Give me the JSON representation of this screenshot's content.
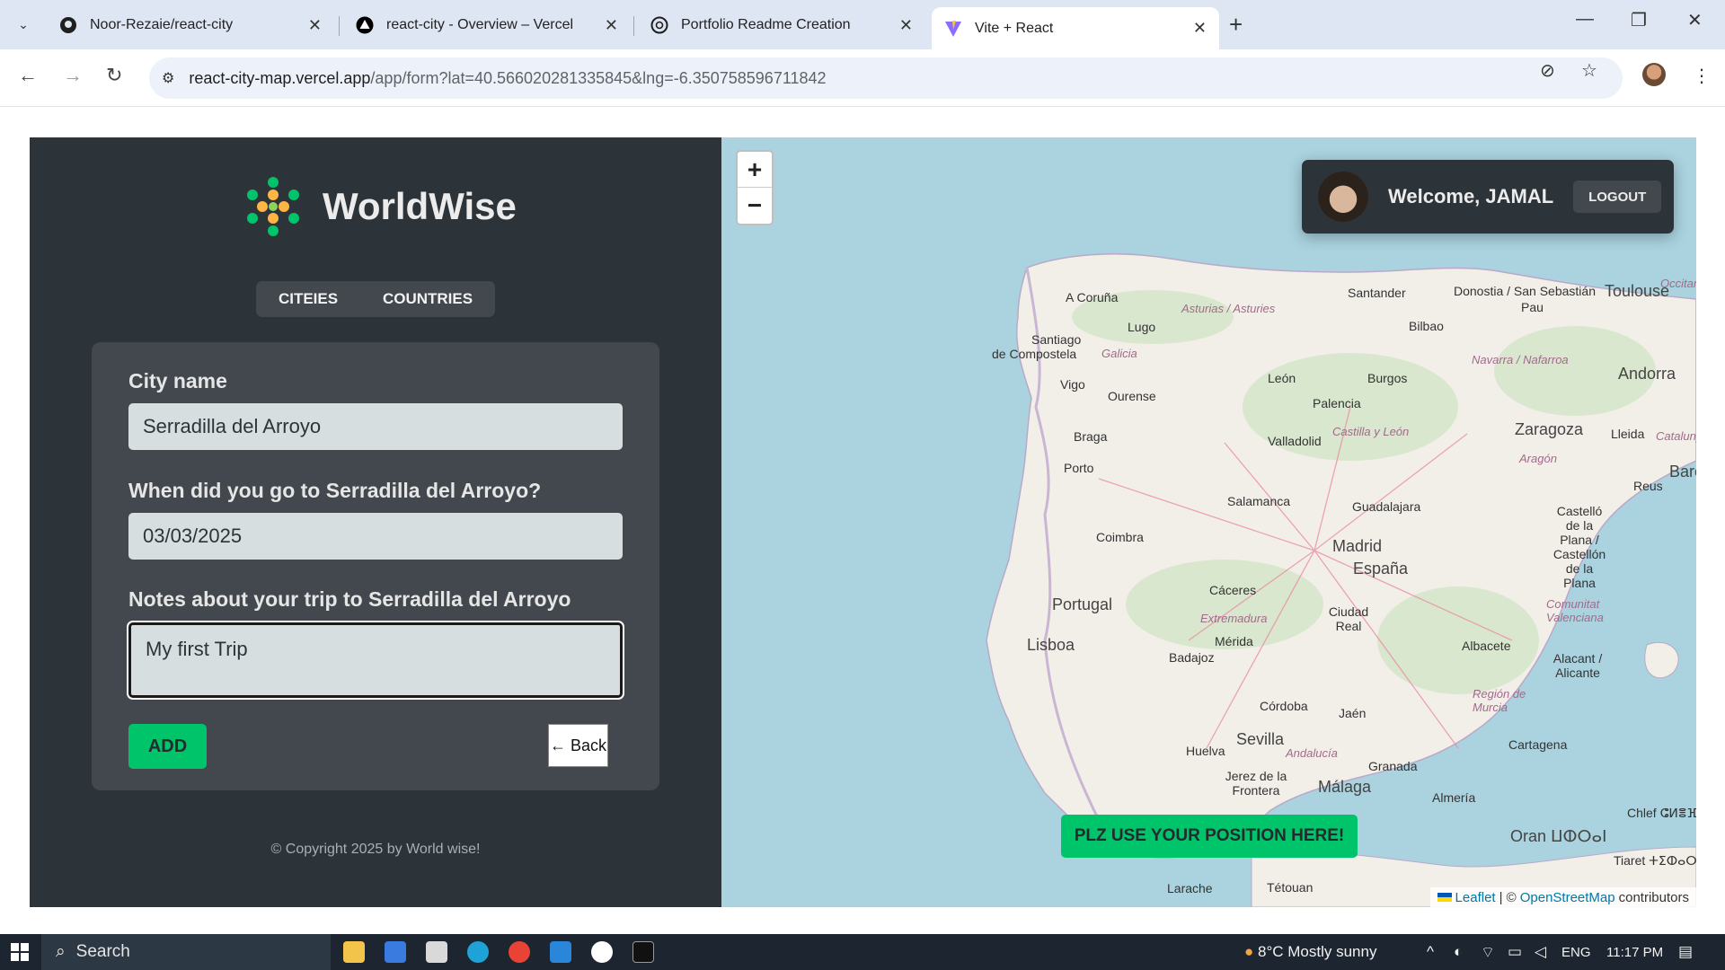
{
  "browser": {
    "tabs": [
      {
        "title": "Noor-Rezaie/react-city",
        "icon": "github-icon"
      },
      {
        "title": "react-city - Overview – Vercel",
        "icon": "vercel-icon"
      },
      {
        "title": "Portfolio Readme Creation",
        "icon": "openai-icon"
      },
      {
        "title": "Vite + React",
        "icon": "vite-icon"
      }
    ],
    "url_host": "react-city-map.vercel.app",
    "url_path": "/app/form?lat=40.566020281335845&lng=-6.350758596711842"
  },
  "sidebar": {
    "logo_text": "WorldWise",
    "nav": {
      "cities": "CITEIES",
      "countries": "COUNTRIES"
    },
    "form": {
      "city_label": "City name",
      "city_value": "Serradilla del Arroyo",
      "date_label": "When did you go to Serradilla del Arroyo?",
      "date_value": "03/03/2025",
      "notes_label": "Notes about your trip to Serradilla del Arroyo",
      "notes_value": "My first Trip",
      "add_label": "ADD",
      "back_label": "← Back"
    },
    "copyright": "© Copyright 2025 by World wise!"
  },
  "map": {
    "zoom_in": "+",
    "zoom_out": "−",
    "welcome": "Welcome, JAMAL",
    "logout": "LOGOUT",
    "position_button": "PLZ USE YOUR POSITION HERE!",
    "attribution_leaflet": "Leaflet",
    "attribution_sep": "| ©",
    "attribution_osm": "OpenStreetMap",
    "attribution_tail": "contributors",
    "labels": {
      "a_coruna": "A Coruña",
      "lugo": "Lugo",
      "santiago": "Santiago",
      "de_compostela": "de Compostela",
      "galicia": "Galicia",
      "vigo": "Vigo",
      "ourense": "Ourense",
      "braga": "Braga",
      "porto": "Porto",
      "coimbra": "Coimbra",
      "portugal": "Portugal",
      "lisboa": "Lisboa",
      "asturias": "Asturias / Asturies",
      "santander": "Santander",
      "donostia": "Donostia / San Sebastián",
      "bilbao": "Bilbao",
      "pau": "Pau",
      "toulouse": "Toulouse",
      "occitanie": "Occitanie",
      "leon": "León",
      "burgos": "Burgos",
      "palencia": "Palencia",
      "navarra": "Navarra / Nafarroa",
      "andorra": "Andorra",
      "valladolid": "Valladolid",
      "castilla": "Castilla y León",
      "zaragoza": "Zaragoza",
      "aragon": "Aragón",
      "lleida": "Lleida",
      "catalunya": "Catalunya",
      "reus": "Reus",
      "barcel": "Barcel",
      "salamanca": "Salamanca",
      "guadalajara": "Guadalajara",
      "madrid": "Madrid",
      "espana": "España",
      "castello": "Castelló de la Plana / Castellón de la Plana",
      "caceres": "Cáceres",
      "extremadura": "Extremadura",
      "merida": "Mérida",
      "badajoz": "Badajoz",
      "ciudad_real": "Ciudad Real",
      "comunitat": "Comunitat Valenciana",
      "albacete": "Albacete",
      "alacant": "Alacant / Alicante",
      "cordoba": "Córdoba",
      "jaen": "Jaén",
      "region_murcia": "Región de Murcia",
      "huelva": "Huelva",
      "sevilla": "Sevilla",
      "andalucia": "Andalucía",
      "cartagena": "Cartagena",
      "jerez": "Jerez de la Frontera",
      "granada": "Granada",
      "malaga": "Málaga",
      "almeria": "Almería",
      "oran": "Oran ⵡⵀⵔⴰⵏ",
      "tiaret": "Tiaret ⵜⵉⵀⴰⵔⵜ",
      "chlef": "Chlef ⵛⵍⴻⴼ",
      "larache": "Larache",
      "tetouan": "Tétouan"
    }
  },
  "taskbar": {
    "search": "Search",
    "weather": "8°C  Mostly sunny",
    "lang": "ENG",
    "time": "11:17 PM"
  }
}
